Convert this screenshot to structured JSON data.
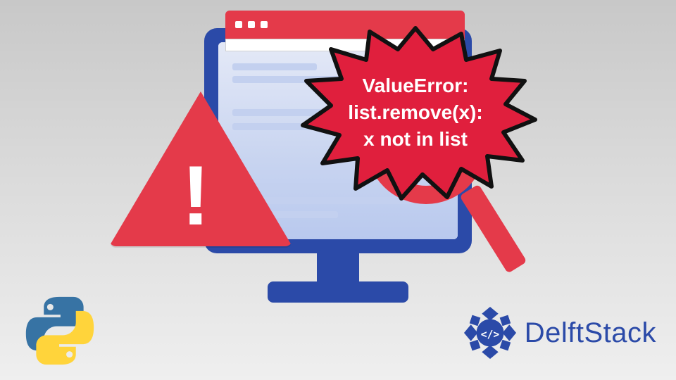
{
  "error_bubble": {
    "line1": "ValueError:",
    "line2": "list.remove(x):",
    "line3": "x not in list"
  },
  "warning": {
    "glyph": "!"
  },
  "brand": {
    "name": "DelftStack"
  },
  "colors": {
    "accent_red": "#e43a4a",
    "brand_blue": "#2b4aa8",
    "python_blue": "#3773a4",
    "python_yellow": "#ffd43b"
  }
}
